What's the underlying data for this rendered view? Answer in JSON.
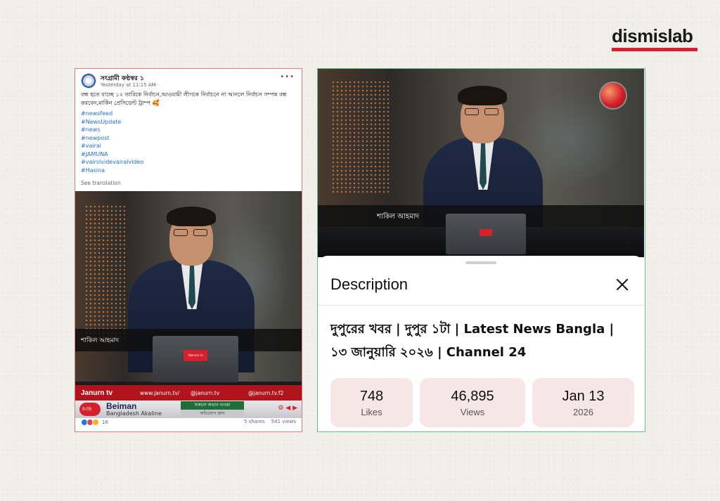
{
  "logo": {
    "text": "dismislab",
    "bar_color": "#d5202d"
  },
  "facebook_post": {
    "page_name": "সংগ্রামী কণ্ঠস্বর ১",
    "timestamp": "Yesterday at 11:15 AM ·",
    "more": "•••",
    "text": "বন্ধ হতে যাচ্ছে ১২ তারিকে নির্বাচন,আওয়ামী লীগকে নির্বাচনে না আনলে নির্বাচন সম্পন্ন বন্ধ করবেন,মার্কিন প্রেসিডেন্ট ট্রাম্প 🥰",
    "hashtags": [
      "#newsfeed",
      "#NewsUpdate",
      "#news",
      "#newpost",
      "#vairal",
      "#JAMUNA",
      "#vairslvidevairalvideo",
      "#Hasina"
    ],
    "see_translation": "See translation",
    "video": {
      "anchor_name": "শাকিল আহমাদ",
      "laptop_logo": "#Janurn tv",
      "ticker_brand": "Janurn tv",
      "ticker_web": "www.janurn.tv/",
      "ticker_fb": "@janurn.tv",
      "ticker_x": "@janurn.tv.f2",
      "ticker_time": "0:05",
      "ticker_headline": "Beiman",
      "ticker_sub": "Bangladesh Akaline",
      "ticker_mid": "শুকনো অভাব খাওয়া",
      "ticker_mid2": "অভিযোগ জন্য"
    },
    "reaction_count": "16",
    "shares": "5 shares",
    "views": "541 views"
  },
  "youtube": {
    "video": {
      "anchor_name": "শাকিল আহমাদ"
    },
    "sheet_title": "Description",
    "video_title": "দুপুরের খবর | দুপুর ১টা | Latest News Bangla | ১৩ জানুয়ারি  ২০২৬ | Channel 24",
    "stats": [
      {
        "value": "748",
        "label": "Likes"
      },
      {
        "value": "46,895",
        "label": "Views"
      },
      {
        "value": "Jan 13",
        "label": "2026"
      }
    ]
  }
}
